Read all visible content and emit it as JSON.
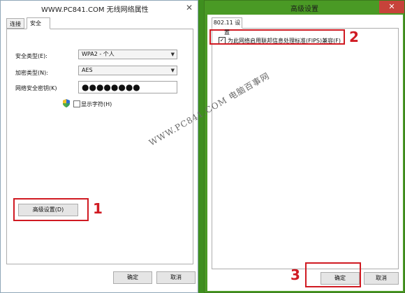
{
  "left_window": {
    "title": "WWW.PC841.COM 无线网络属性",
    "close_glyph": "✕",
    "tabs": [
      {
        "label": "连接",
        "selected": false
      },
      {
        "label": "安全",
        "selected": true
      }
    ],
    "security_type": {
      "label": "安全类型(E):",
      "value": "WPA2 - 个人"
    },
    "encryption_type": {
      "label": "加密类型(N):",
      "value": "AES"
    },
    "network_key": {
      "label": "网络安全密钥(K)",
      "value": "●●●●●●●●"
    },
    "show_chars": {
      "label": "显示字符(H)",
      "checked": false
    },
    "advanced_button": "高级设置(D)",
    "ok_button": "确定",
    "cancel_button": "取消"
  },
  "right_window": {
    "title": "高级设置",
    "close_glyph": "✕",
    "tab_label": "802.11 设置",
    "fips": {
      "label": "为此网络启用联邦信息处理标准(FIPS)兼容(F)",
      "checked": true
    },
    "ok_button": "确定",
    "cancel_button": "取消"
  },
  "annotations": {
    "step1": "1",
    "step2": "2",
    "step3": "3"
  },
  "watermark": "WWW.PC841.COM 电脑百事网",
  "colors": {
    "annotation_red": "#d01a22",
    "right_window_frame": "#4a9a25",
    "close_button": "#c7433a"
  }
}
